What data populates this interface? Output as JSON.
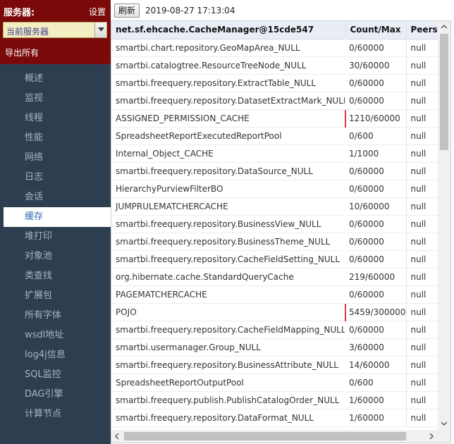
{
  "sidebar": {
    "server_label": "服务器:",
    "settings_label": "设置",
    "server_select_value": "当前服务器",
    "export_all_label": "导出所有",
    "nav_items": [
      {
        "label": "概述"
      },
      {
        "label": "监视"
      },
      {
        "label": "线程"
      },
      {
        "label": "性能"
      },
      {
        "label": "网络"
      },
      {
        "label": "日志"
      },
      {
        "label": "会话"
      },
      {
        "label": "缓存",
        "active": true
      },
      {
        "label": "堆打印"
      },
      {
        "label": "对象池"
      },
      {
        "label": "类查找"
      },
      {
        "label": "扩展包"
      },
      {
        "label": "所有字体"
      },
      {
        "label": "wsdl地址"
      },
      {
        "label": "log4j信息"
      },
      {
        "label": "SQL监控"
      },
      {
        "label": "DAG引擎"
      },
      {
        "label": "计算节点"
      }
    ]
  },
  "toolbar": {
    "refresh_label": "刷新",
    "timestamp": "2019-08-27 17:13:04"
  },
  "table": {
    "headers": [
      "net.sf.ehcache.CacheManager@15cde547",
      "Count/Max",
      "Peers"
    ],
    "rows": [
      {
        "name": "smartbi.chart.repository.GeoMapArea_NULL",
        "count": "0/60000",
        "peers": "null"
      },
      {
        "name": "smartbi.catalogtree.ResourceTreeNode_NULL",
        "count": "30/60000",
        "peers": "null"
      },
      {
        "name": "smartbi.freequery.repository.ExtractTable_NULL",
        "count": "0/60000",
        "peers": "null"
      },
      {
        "name": "smartbi.freequery.repository.DatasetExtractMark_NULL",
        "count": "0/60000",
        "peers": "null"
      },
      {
        "name": "ASSIGNED_PERMISSION_CACHE",
        "count": "1210/60000",
        "peers": "null",
        "highlight": true
      },
      {
        "name": "SpreadsheetReportExecutedReportPool",
        "count": "0/600",
        "peers": "null"
      },
      {
        "name": "Internal_Object_CACHE",
        "count": "1/1000",
        "peers": "null"
      },
      {
        "name": "smartbi.freequery.repository.DataSource_NULL",
        "count": "0/60000",
        "peers": "null"
      },
      {
        "name": "HierarchyPurviewFilterBO",
        "count": "0/60000",
        "peers": "null"
      },
      {
        "name": "JUMPRULEMATCHERCACHE",
        "count": "10/60000",
        "peers": "null"
      },
      {
        "name": "smartbi.freequery.repository.BusinessView_NULL",
        "count": "0/60000",
        "peers": "null"
      },
      {
        "name": "smartbi.freequery.repository.BusinessTheme_NULL",
        "count": "0/60000",
        "peers": "null"
      },
      {
        "name": "smartbi.freequery.repository.CacheFieldSetting_NULL",
        "count": "0/60000",
        "peers": "null"
      },
      {
        "name": "org.hibernate.cache.StandardQueryCache",
        "count": "219/60000",
        "peers": "null"
      },
      {
        "name": "PAGEMATCHERCACHE",
        "count": "0/60000",
        "peers": "null"
      },
      {
        "name": "POJO",
        "count": "5459/300000",
        "peers": "null",
        "highlight": true
      },
      {
        "name": "smartbi.freequery.repository.CacheFieldMapping_NULL",
        "count": "0/60000",
        "peers": "null"
      },
      {
        "name": "smartbi.usermanager.Group_NULL",
        "count": "3/60000",
        "peers": "null"
      },
      {
        "name": "smartbi.freequery.repository.BusinessAttribute_NULL",
        "count": "14/60000",
        "peers": "null"
      },
      {
        "name": "SpreadsheetReportOutputPool",
        "count": "0/600",
        "peers": "null"
      },
      {
        "name": "smartbi.freequery.publish.PublishCatalogOrder_NULL",
        "count": "1/60000",
        "peers": "null"
      },
      {
        "name": "smartbi.freequery.repository.DataFormat_NULL",
        "count": "1/60000",
        "peers": "null"
      }
    ]
  },
  "icons": {
    "select_arrow": "chevron-down-icon",
    "scroll_up": "scroll-up-arrow-icon",
    "scroll_down": "scroll-down-arrow-icon",
    "scroll_left": "scroll-left-arrow-icon",
    "scroll_right": "scroll-right-arrow-icon"
  },
  "colors": {
    "header_bg": "#7a0a0a",
    "sidebar_bg": "#2d3e50",
    "active_item_text": "#2d6ab4",
    "warn_marker": "#e03a4a"
  }
}
